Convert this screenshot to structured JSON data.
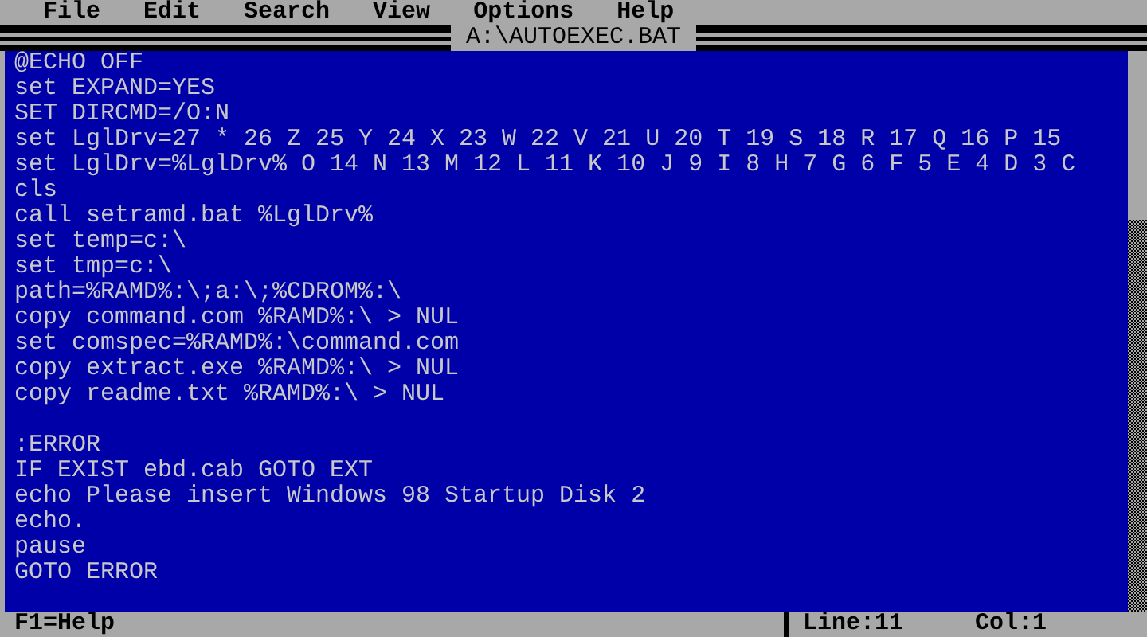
{
  "menu": [
    "File",
    "Edit",
    "Search",
    "View",
    "Options",
    "Help"
  ],
  "window": {
    "title": "A:\\AUTOEXEC.BAT"
  },
  "editor": {
    "blocks": [
      [
        "@ECHO OFF",
        "set EXPAND=YES",
        "SET DIRCMD=/O:N",
        "set LglDrv=27 * 26 Z 25 Y 24 X 23 W 22 V 21 U 20 T 19 S 18 R 17 Q 16 P 15",
        "set LglDrv=%LglDrv% O 14 N 13 M 12 L 11 K 10 J 9 I 8 H 7 G 6 F 5 E 4 D 3 C",
        "cls",
        "call setramd.bat %LglDrv%",
        "set temp=c:\\",
        "set tmp=c:\\",
        "path=%RAMD%:\\;a:\\;%CDROM%:\\",
        "copy command.com %RAMD%:\\ > NUL",
        "set comspec=%RAMD%:\\command.com",
        "copy extract.exe %RAMD%:\\ > NUL",
        "copy readme.txt %RAMD%:\\ > NUL"
      ],
      [
        ":ERROR",
        "IF EXIST ebd.cab GOTO EXT",
        "echo Please insert Windows 98 Startup Disk 2",
        "echo.",
        "pause",
        "GOTO ERROR"
      ]
    ]
  },
  "status_bar": {
    "help": "F1=Help",
    "line": "Line:11",
    "column": "Col:1"
  }
}
